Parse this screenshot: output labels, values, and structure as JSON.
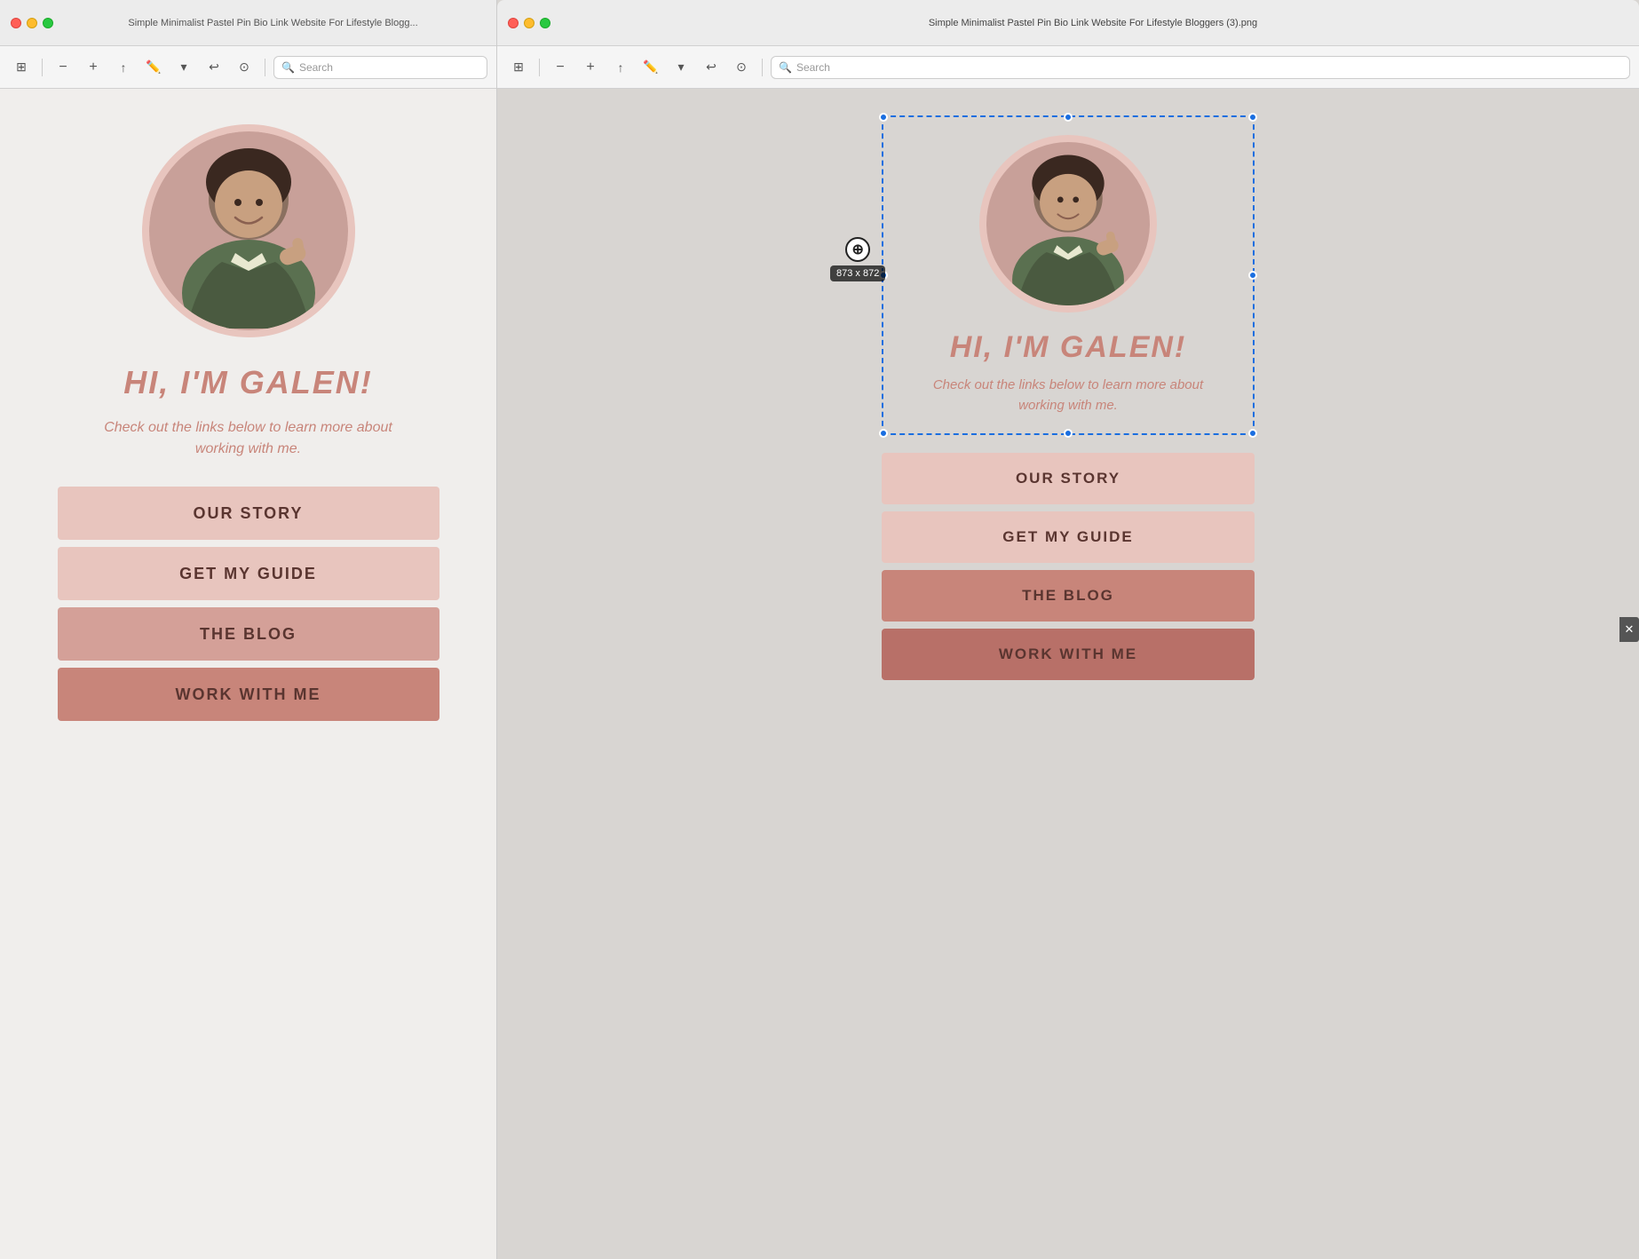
{
  "leftWindow": {
    "titleBar": {
      "title": "Simple Minimalist Pastel Pin Bio Link Website For Lifestyle Blogg..."
    },
    "toolbar": {
      "searchPlaceholder": "Search"
    },
    "content": {
      "heading": "HI, I'M GALEN!",
      "subtext": "Check out the links below to learn more about working with me.",
      "buttons": [
        {
          "label": "OUR STORY",
          "style": "light"
        },
        {
          "label": "GET MY GUIDE",
          "style": "light"
        },
        {
          "label": "THE BLOG",
          "style": "medium"
        },
        {
          "label": "WORK WITH ME",
          "style": "dark"
        }
      ]
    }
  },
  "rightWindow": {
    "titleBar": {
      "title": "Simple Minimalist Pastel Pin Bio Link Website For Lifestyle Bloggers (3).png"
    },
    "toolbar": {
      "searchPlaceholder": "Search"
    },
    "content": {
      "heading": "HI, I'M GALEN!",
      "subtext": "Check out the links below to learn more about working with me.",
      "sizeTooltip": "873 x 872",
      "buttons": [
        {
          "label": "OUR STORY",
          "style": "light"
        },
        {
          "label": "GET MY GUIDE",
          "style": "light"
        },
        {
          "label": "THE BLOG",
          "style": "medium"
        },
        {
          "label": "WORK WITH ME",
          "style": "dark"
        }
      ]
    }
  },
  "colors": {
    "btnLight": "#e8c5be",
    "btnMedium": "#d4a098",
    "btnDark": "#c8857a",
    "btnDarkest": "#b87068",
    "headingColor": "#c8857a",
    "subtextColor": "#c8857a",
    "selectionBlue": "#1a6ee0"
  }
}
